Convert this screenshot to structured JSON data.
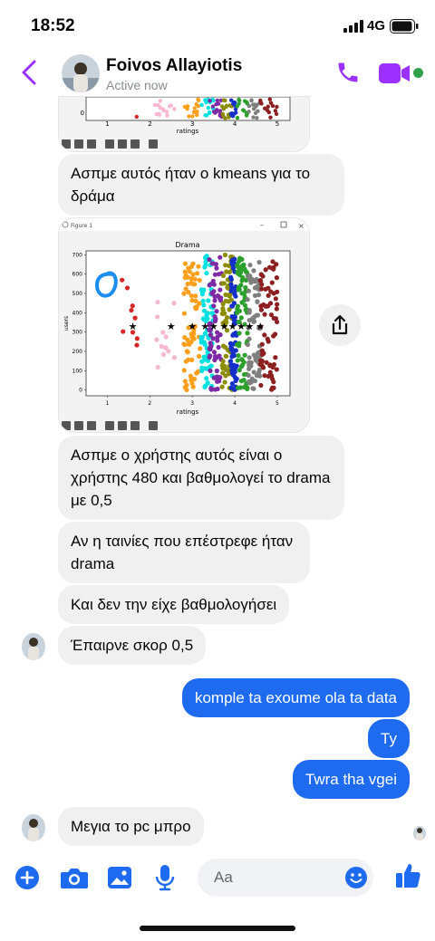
{
  "status_bar": {
    "time": "18:52",
    "network": "4G",
    "icons": [
      "signal-icon",
      "battery-icon"
    ]
  },
  "header": {
    "name": "Foivos Allayiotis",
    "status": "Active now",
    "icons": [
      "back-icon",
      "phone-icon",
      "video-icon"
    ]
  },
  "plot_window": {
    "title": "Figure 1",
    "toolbar_icons": [
      "home-icon",
      "back-arrow-icon",
      "forward-arrow-icon",
      "pan-icon",
      "zoom-icon",
      "configure-icon",
      "save-icon"
    ]
  },
  "chart_data": [
    {
      "type": "scatter",
      "xlabel": "ratings",
      "x_ticks": [
        "1",
        "2",
        "3",
        "4",
        "5"
      ],
      "y_ticks": [
        "0"
      ]
    },
    {
      "type": "scatter",
      "title": "Drama",
      "xlabel": "ratings",
      "ylabel": "users",
      "xlim": [
        0.5,
        5.3
      ],
      "ylim": [
        -30,
        720
      ],
      "x_ticks": [
        "1",
        "2",
        "3",
        "4",
        "5"
      ],
      "y_ticks": [
        "0",
        "100",
        "200",
        "300",
        "400",
        "500",
        "600",
        "700"
      ],
      "centroids": {
        "name": "★",
        "x": [
          1.6,
          2.5,
          3.0,
          3.3,
          3.5,
          3.75,
          3.95,
          4.15,
          4.35,
          4.6
        ],
        "y": [
          330,
          330,
          330,
          330,
          330,
          330,
          330,
          330,
          330,
          330
        ]
      },
      "clusters": [
        {
          "color": "#d62728",
          "x_range": [
            1.3,
            1.9
          ],
          "y_range": [
            200,
            620
          ]
        },
        {
          "color": "#f7b6d2",
          "x_range": [
            2.1,
            2.6
          ],
          "y_range": [
            100,
            460
          ]
        },
        {
          "color": "#ff9f1c",
          "x_range": [
            2.8,
            3.2
          ],
          "y_range": [
            0,
            660
          ]
        },
        {
          "color": "#00e0e0",
          "x_range": [
            3.2,
            3.5
          ],
          "y_range": [
            0,
            700
          ]
        },
        {
          "color": "#7f2aa5",
          "x_range": [
            3.4,
            3.7
          ],
          "y_range": [
            0,
            690
          ]
        },
        {
          "color": "#8c8c00",
          "x_range": [
            3.7,
            3.95
          ],
          "y_range": [
            0,
            700
          ]
        },
        {
          "color": "#1430c8",
          "x_range": [
            3.9,
            4.05
          ],
          "y_range": [
            0,
            700
          ]
        },
        {
          "color": "#2ca02c",
          "x_range": [
            4.05,
            4.3
          ],
          "y_range": [
            0,
            690
          ]
        },
        {
          "color": "#7f7f7f",
          "x_range": [
            4.3,
            4.6
          ],
          "y_range": [
            0,
            690
          ]
        },
        {
          "color": "#8c1f1f",
          "x_range": [
            4.6,
            5.0
          ],
          "y_range": [
            0,
            680
          ]
        }
      ]
    }
  ],
  "messages": [
    {
      "text": "Ασπμε αυτός ήταν ο kmeans για το δράμα"
    },
    {
      "text": "Ασπμε ο χρήστης αυτός είναι ο χρήστης 480 και βαθμολογεί το drama με 0,5"
    },
    {
      "text": "Αν η ταινίες που επέστρεφε ήταν drama"
    },
    {
      "text": "Και δεν την είχε βαθμολογήσει"
    },
    {
      "text": "Έπαιρνε σκορ 0,5"
    },
    {
      "text": "komple ta exoume ola ta data"
    },
    {
      "text": "Ty"
    },
    {
      "text": "Twra tha vgei"
    },
    {
      "text": "Μεγια το pc μπρο"
    }
  ],
  "composer": {
    "placeholder": "Aa",
    "icons": [
      "plus-icon",
      "camera-icon",
      "gallery-icon",
      "mic-icon",
      "emoji-icon",
      "like-icon"
    ]
  },
  "colors": {
    "accent": "#1e6bf0",
    "purple": "#9b30ff",
    "incoming_bubble": "#f0f0f0",
    "online": "#31a24c"
  }
}
